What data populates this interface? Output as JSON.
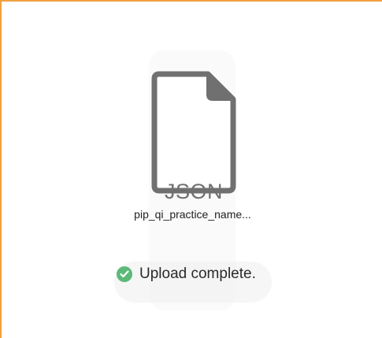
{
  "upload": {
    "file_type_label": "JSON",
    "file_name": "pip_qi_practice_name...",
    "status_text": "Upload complete.",
    "file_icon": "json-file-icon",
    "status_icon": "check-circle-icon"
  },
  "colors": {
    "frame_accent": "#f0a040",
    "success": "#5cb978",
    "icon_gray": "#707070"
  }
}
